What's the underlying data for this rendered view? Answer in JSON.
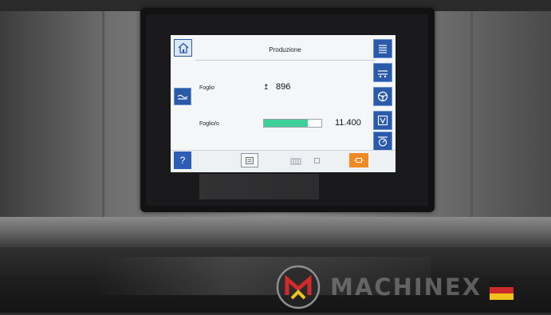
{
  "screen": {
    "title": "Produzione",
    "rows": [
      {
        "label": "Foglio",
        "indicator": "↥",
        "value": "896"
      },
      {
        "label": "Foglio/o",
        "value": "11.400",
        "progress": 0.77
      }
    ],
    "help_label": "?"
  },
  "icons": {
    "home": "home-icon",
    "left": [
      "sheet-stack-icon"
    ],
    "right": [
      "feeder-icon",
      "conveyor-icon",
      "steering-wheel-icon",
      "vacuum-icon",
      "gauge-icon"
    ],
    "footer": [
      "sheet-counter-icon",
      "blanket-icon",
      "indicator-dot-icon",
      "orange-toggle-icon"
    ]
  },
  "colors": {
    "accent": "#2a5aa8",
    "progress": "#3fcf9a",
    "footer_toggle": "#f08a24"
  },
  "watermark": {
    "text": "MACHINEX"
  }
}
